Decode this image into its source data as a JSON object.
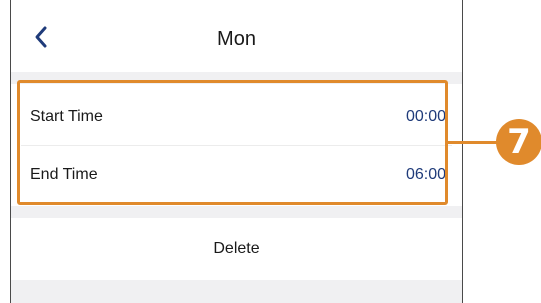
{
  "header": {
    "back_icon": "chevron-left-icon",
    "title": "Mon"
  },
  "schedule": {
    "start_label": "Start Time",
    "start_value": "00:00",
    "end_label": "End Time",
    "end_value": "06:00"
  },
  "actions": {
    "delete_label": "Delete"
  },
  "callout": {
    "number": "7",
    "color": "#e08a2c"
  },
  "colors": {
    "value_text": "#1f3b7a",
    "back_icon": "#1f3b7a",
    "background": "#f0f0f2"
  }
}
